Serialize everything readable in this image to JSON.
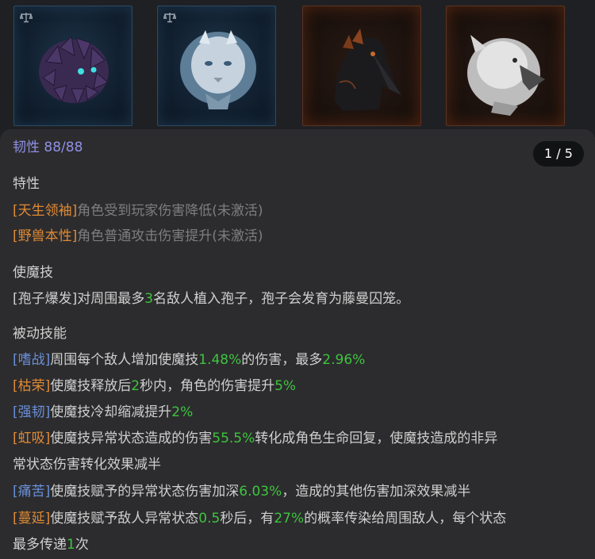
{
  "cards": [
    {
      "name": "spore-beast-card",
      "frame": "blue",
      "has_balance_icon": true
    },
    {
      "name": "white-lion-card",
      "frame": "blue",
      "has_balance_icon": true
    },
    {
      "name": "dark-bird-card",
      "frame": "orange",
      "has_balance_icon": false
    },
    {
      "name": "white-griffin-card",
      "frame": "orange",
      "has_balance_icon": false
    }
  ],
  "toughness": "韧性 88/88",
  "pager": "1 / 5",
  "traits": {
    "header": "特性",
    "items": [
      {
        "tag": "[天生领袖]",
        "text": "角色受到玩家伤害降低(未激活)"
      },
      {
        "tag": "[野兽本性]",
        "text": "角色普通攻击伤害提升(未激活)"
      }
    ]
  },
  "skill": {
    "header": "使魔技",
    "p1": "[孢子爆发]对周围最多",
    "n1": "3",
    "p2": "名敌人植入孢子，孢子会发育为藤曼囚笼。"
  },
  "passives": {
    "header": "被动技能",
    "r1": {
      "tag": "[嗜战]",
      "a": "周围每个敌人增加使魔技",
      "v1": "1.48%",
      "b": "的伤害，最多",
      "v2": "2.96%"
    },
    "r2": {
      "tag": "[枯荣]",
      "a": "使魔技释放后",
      "v1": "2",
      "b": "秒内，角色的伤害提升",
      "v2": "5%"
    },
    "r3": {
      "tag": "[强韧]",
      "a": "使魔技冷却缩减提升",
      "v1": "2%"
    },
    "r4": {
      "tag": "[虹吸]",
      "a": "使魔技异常状态造成的伤害",
      "v1": "55.5%",
      "b": "转化成角色生命回复，使魔技造成的非异",
      "c": "常状态伤害转化效果减半"
    },
    "r5": {
      "tag": "[痛苦]",
      "a": "使魔技赋予的异常状态伤害加深",
      "v1": "6.03%",
      "b": "，造成的其他伤害加深效果减半"
    },
    "r6": {
      "tag": "[蔓延]",
      "a": "使魔技赋予敌人异常状态",
      "v1": "0.5",
      "b": "秒后，有",
      "v2": "27%",
      "c": "的概率传染给周围敌人，每个状态",
      "d": "最多传递",
      "v3": "1",
      "e": "次"
    }
  },
  "colors": {
    "toughness": "#8f8fe6",
    "gold_tag": "#e08a34",
    "blue_tag": "#6a8fd8",
    "number": "#3ec43e",
    "inactive": "#7e7e7e"
  }
}
